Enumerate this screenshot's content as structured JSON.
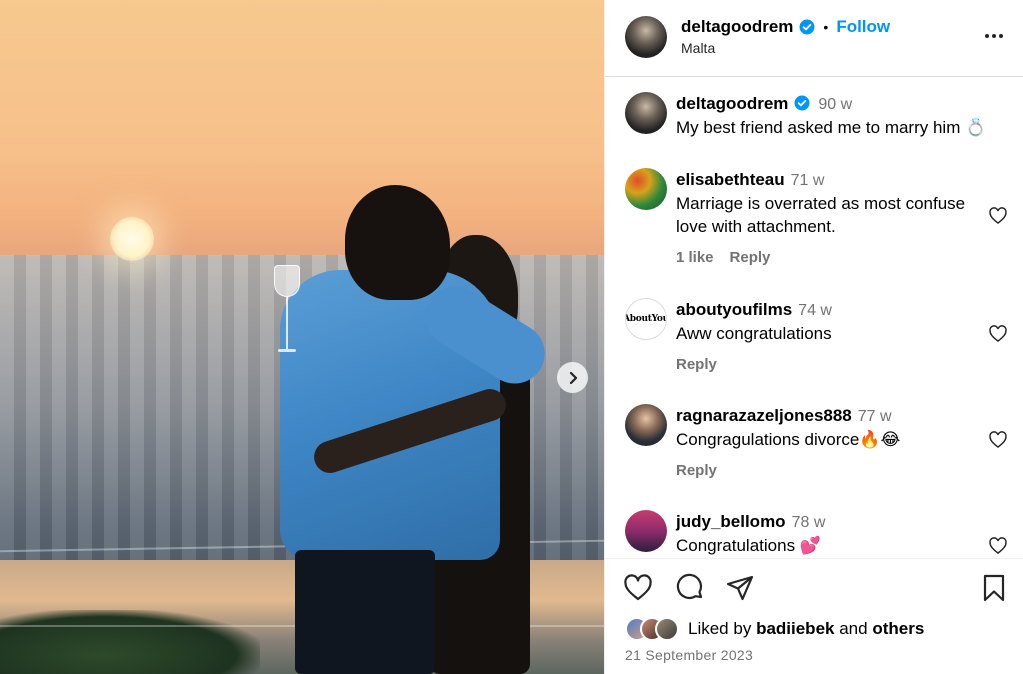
{
  "post": {
    "author": "deltagoodrem",
    "location": "Malta",
    "follow_label": "Follow",
    "separator": "•",
    "caption": {
      "username": "deltagoodrem",
      "time": "90 w",
      "text": "My best friend asked me to marry him 💍"
    }
  },
  "comments": [
    {
      "username": "elisabethteau",
      "time": "71 w",
      "text": "Marriage is overrated as most confuse love with attachment.",
      "likes": "1 like",
      "reply": "Reply"
    },
    {
      "username": "aboutyoufilms",
      "time": "74 w",
      "text": "Aww congratulations",
      "likes": "",
      "reply": "Reply",
      "avatar_text": "AboutYou"
    },
    {
      "username": "ragnarazazeljones888",
      "time": "77 w",
      "text": "Congragulations divorce🔥😂",
      "likes": "",
      "reply": "Reply"
    },
    {
      "username": "judy_bellomo",
      "time": "78 w",
      "text": "Congratulations 💕",
      "likes": "",
      "reply": ""
    }
  ],
  "footer": {
    "liked_by_prefix": "Liked by",
    "liked_by_user": "badiiebek",
    "liked_by_and": "and",
    "liked_by_others": "others",
    "date": "21 September 2023"
  },
  "icons": {
    "verified": "verified-badge-icon",
    "more": "more-options-icon",
    "next": "chevron-right-icon",
    "like": "heart-icon",
    "comment": "comment-bubble-icon",
    "share": "paper-plane-icon",
    "save": "bookmark-icon"
  },
  "colors": {
    "accent": "#0095f6",
    "verified": "#0095f6",
    "muted": "#737373"
  }
}
